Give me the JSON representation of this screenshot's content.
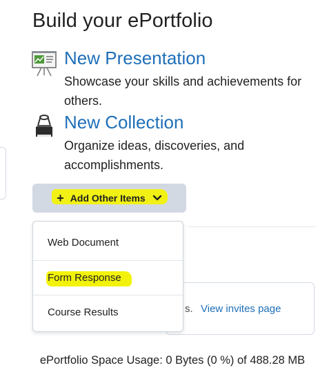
{
  "page": {
    "title": "Build your ePortfolio"
  },
  "create_items": [
    {
      "link": "New Presentation",
      "description": "Showcase your skills and achievements for others.",
      "icon": "presentation-easel-icon"
    },
    {
      "link": "New Collection",
      "description": "Organize ideas, discoveries, and accomplishments.",
      "icon": "binder-clip-icon"
    }
  ],
  "add_menu": {
    "button_label": "Add Other Items",
    "plus_glyph": "+",
    "items": [
      {
        "label": "Web Document"
      },
      {
        "label": "Form Response"
      },
      {
        "label": "Course Results"
      }
    ]
  },
  "invites": {
    "partial_text": "s.",
    "link_label": "View invites page"
  },
  "space_usage": {
    "text": "ePortfolio Space Usage: 0 Bytes (0 %) of 488.28 MB"
  },
  "colors": {
    "link": "#1e6fb8",
    "highlight": "#f2f20a",
    "button_bg": "#d3d9e3",
    "text": "#202122"
  }
}
